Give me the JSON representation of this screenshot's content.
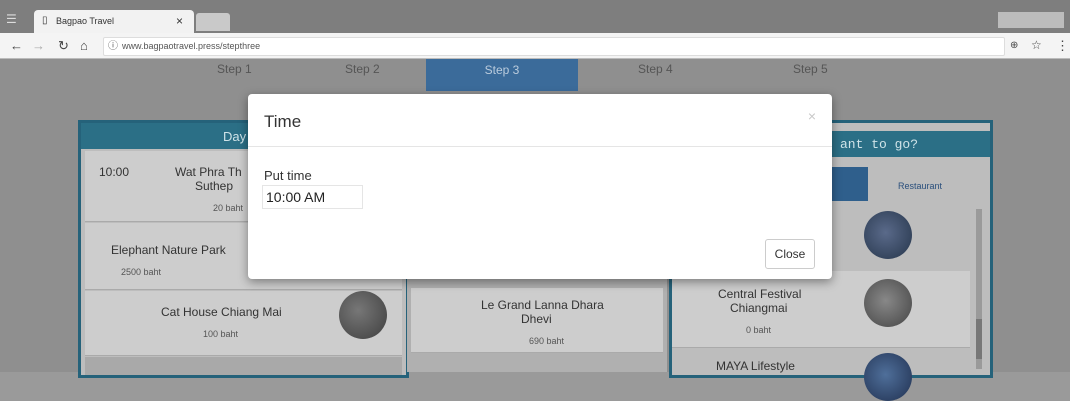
{
  "browser": {
    "tab_title": "Bagpao Travel",
    "tab_close": "×",
    "url": "www.bagpaotravel.press/stepthree"
  },
  "steps": [
    "Step 1",
    "Step 2",
    "Step 3",
    "Step 4",
    "Step 5"
  ],
  "left_panel": {
    "header": "Day",
    "items": [
      {
        "time": "10:00",
        "name": "Wat Phra Th... Suthep",
        "name_line1": "Wat Phra Th",
        "name_line2": "Suthep",
        "price": "20 baht"
      },
      {
        "name": "Elephant Nature Park",
        "price": "2500 baht"
      },
      {
        "name": "Cat House Chiang Mai",
        "price": "100 baht"
      }
    ]
  },
  "middle_panel": {
    "items": [
      {
        "name_line1": "Le Grand Lanna Dhara",
        "name_line2": "Dhevi",
        "price": "690 baht"
      }
    ]
  },
  "right_panel": {
    "header": "ant to go?",
    "tab_restaurant": "Restaurant",
    "items": [
      {
        "name_line1": "Central Festival",
        "name_line2": "Chiangmai",
        "price": "0 baht"
      },
      {
        "name": "MAYA Lifestyle"
      }
    ]
  },
  "modal": {
    "title": "Time",
    "close_x": "×",
    "label": "Put time",
    "input_value": "10:00 AM",
    "close_button": "Close"
  },
  "colors": {
    "panel_header": "#2b6f86",
    "active_step": "#3b6b9a"
  }
}
